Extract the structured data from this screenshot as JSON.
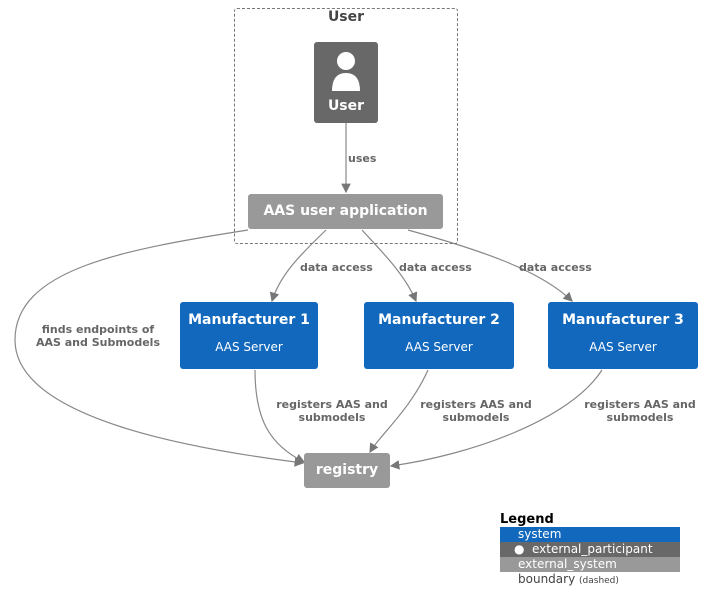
{
  "boundary": {
    "label": "User"
  },
  "nodes": {
    "user": {
      "label": "User",
      "icon": "person-icon"
    },
    "app": {
      "label": "AAS user application"
    },
    "m1": {
      "label": "Manufacturer 1",
      "desc": "AAS Server"
    },
    "m2": {
      "label": "Manufacturer 2",
      "desc": "AAS Server"
    },
    "m3": {
      "label": "Manufacturer 3",
      "desc": "AAS Server"
    },
    "registry": {
      "label": "registry"
    }
  },
  "edges": {
    "uses": "uses",
    "da1": "data access",
    "da2": "data access",
    "da3": "data access",
    "finds_1": "finds endpoints of",
    "finds_2": "AAS and Submodels",
    "reg1_1": "registers AAS and",
    "reg1_2": "submodels",
    "reg2_1": "registers AAS and",
    "reg2_2": "submodels",
    "reg3_1": "registers AAS and",
    "reg3_2": "submodels"
  },
  "legend": {
    "title": "Legend",
    "items": [
      {
        "label": "system",
        "color": "#1168BD"
      },
      {
        "label": "external_participant",
        "color": "#686868"
      },
      {
        "label": "external_system",
        "color": "#999999"
      },
      {
        "label": "boundary",
        "note": "(dashed)"
      }
    ]
  },
  "colors": {
    "system": "#1168BD",
    "person": "#686868",
    "external": "#999999"
  }
}
